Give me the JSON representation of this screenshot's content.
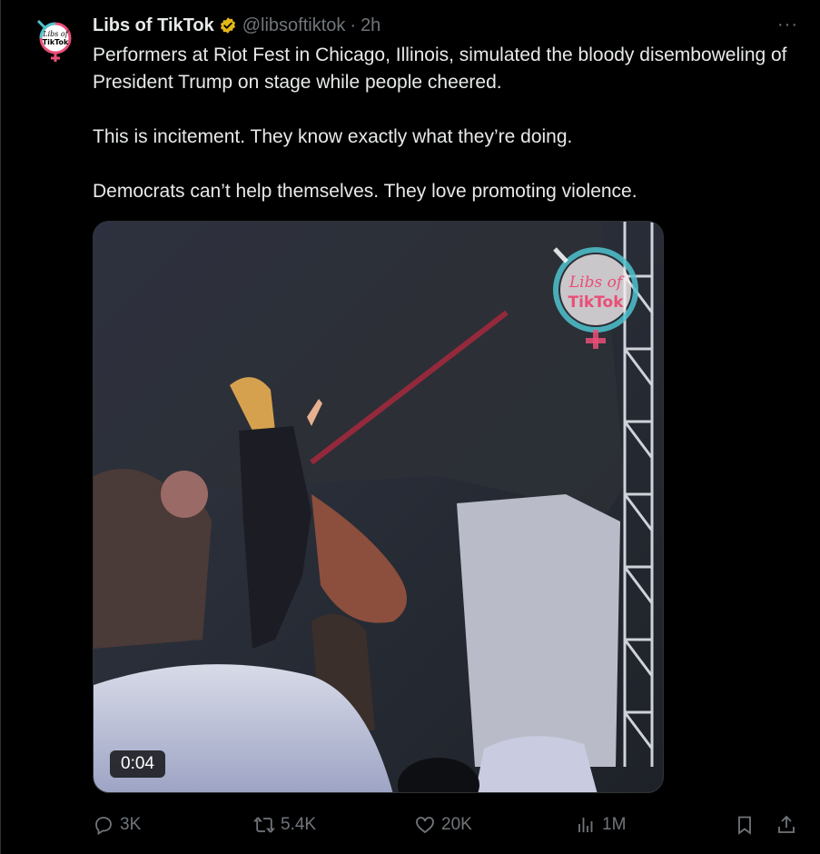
{
  "tweet": {
    "display_name": "Libs of TikTok",
    "handle": "@libsoftiktok",
    "separator": "·",
    "time": "2h",
    "more": "···",
    "avatar_text_line1": "Libs of",
    "avatar_text_line2": "TikTok",
    "paragraphs": [
      "Performers at Riot Fest in Chicago, Illinois, simulated the bloody disemboweling of President Trump on stage while people cheered.",
      "This is incitement. They know exactly what they’re doing.",
      "Democrats can’t help themselves. They love promoting violence."
    ]
  },
  "media": {
    "duration": "0:04",
    "watermark_line1": "Libs of",
    "watermark_line2": "TikTok"
  },
  "actions": {
    "replies": "3K",
    "reposts": "5.4K",
    "likes": "20K",
    "views": "1M"
  },
  "colors": {
    "background": "#000000",
    "text": "#e7e9ea",
    "muted": "#71767b",
    "verified_gold": "#e2b719",
    "brand_pink": "#e94e77",
    "brand_teal": "#4fc3cf"
  }
}
